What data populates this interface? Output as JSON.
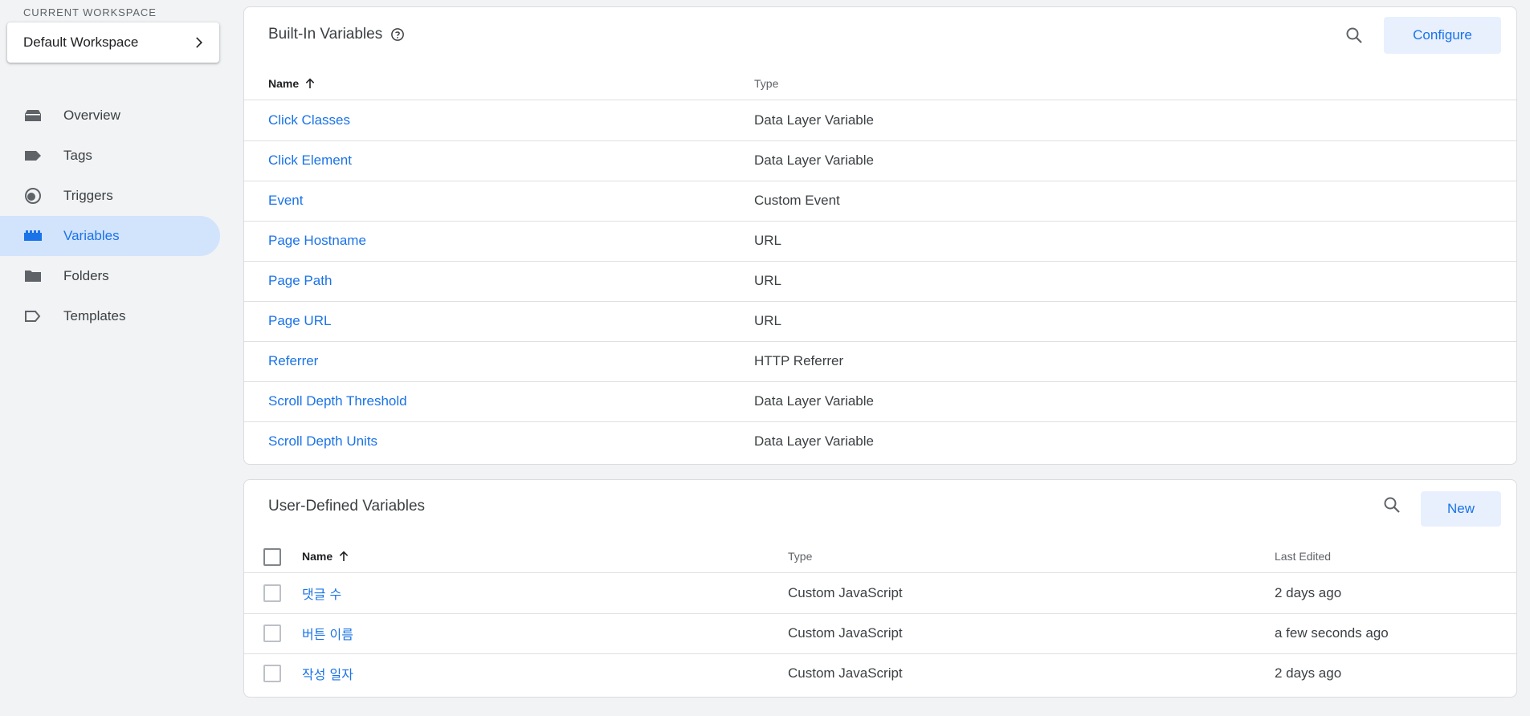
{
  "sidebar": {
    "workspace_label": "CURRENT WORKSPACE",
    "workspace_name": "Default Workspace",
    "items": [
      {
        "label": "Overview",
        "icon": "overview-icon"
      },
      {
        "label": "Tags",
        "icon": "tag-icon"
      },
      {
        "label": "Triggers",
        "icon": "trigger-icon"
      },
      {
        "label": "Variables",
        "icon": "variables-icon",
        "active": true
      },
      {
        "label": "Folders",
        "icon": "folder-icon"
      },
      {
        "label": "Templates",
        "icon": "template-icon"
      }
    ]
  },
  "builtin": {
    "title": "Built-In Variables",
    "configure_label": "Configure",
    "columns": {
      "name": "Name",
      "type": "Type"
    },
    "rows": [
      {
        "name": "Click Classes",
        "type": "Data Layer Variable"
      },
      {
        "name": "Click Element",
        "type": "Data Layer Variable"
      },
      {
        "name": "Event",
        "type": "Custom Event"
      },
      {
        "name": "Page Hostname",
        "type": "URL"
      },
      {
        "name": "Page Path",
        "type": "URL"
      },
      {
        "name": "Page URL",
        "type": "URL"
      },
      {
        "name": "Referrer",
        "type": "HTTP Referrer"
      },
      {
        "name": "Scroll Depth Threshold",
        "type": "Data Layer Variable"
      },
      {
        "name": "Scroll Depth Units",
        "type": "Data Layer Variable"
      }
    ]
  },
  "userdefined": {
    "title": "User-Defined Variables",
    "new_label": "New",
    "columns": {
      "name": "Name",
      "type": "Type",
      "edited": "Last Edited"
    },
    "rows": [
      {
        "name": "댓글 수",
        "type": "Custom JavaScript",
        "edited": "2 days ago"
      },
      {
        "name": "버튼 이름",
        "type": "Custom JavaScript",
        "edited": "a few seconds ago"
      },
      {
        "name": "작성 일자",
        "type": "Custom JavaScript",
        "edited": "2 days ago"
      }
    ]
  },
  "colors": {
    "accent": "#1a73e8",
    "active_bg": "#d2e3fc",
    "button_bg": "#e8f0fe",
    "page_bg": "#f1f3f4"
  }
}
